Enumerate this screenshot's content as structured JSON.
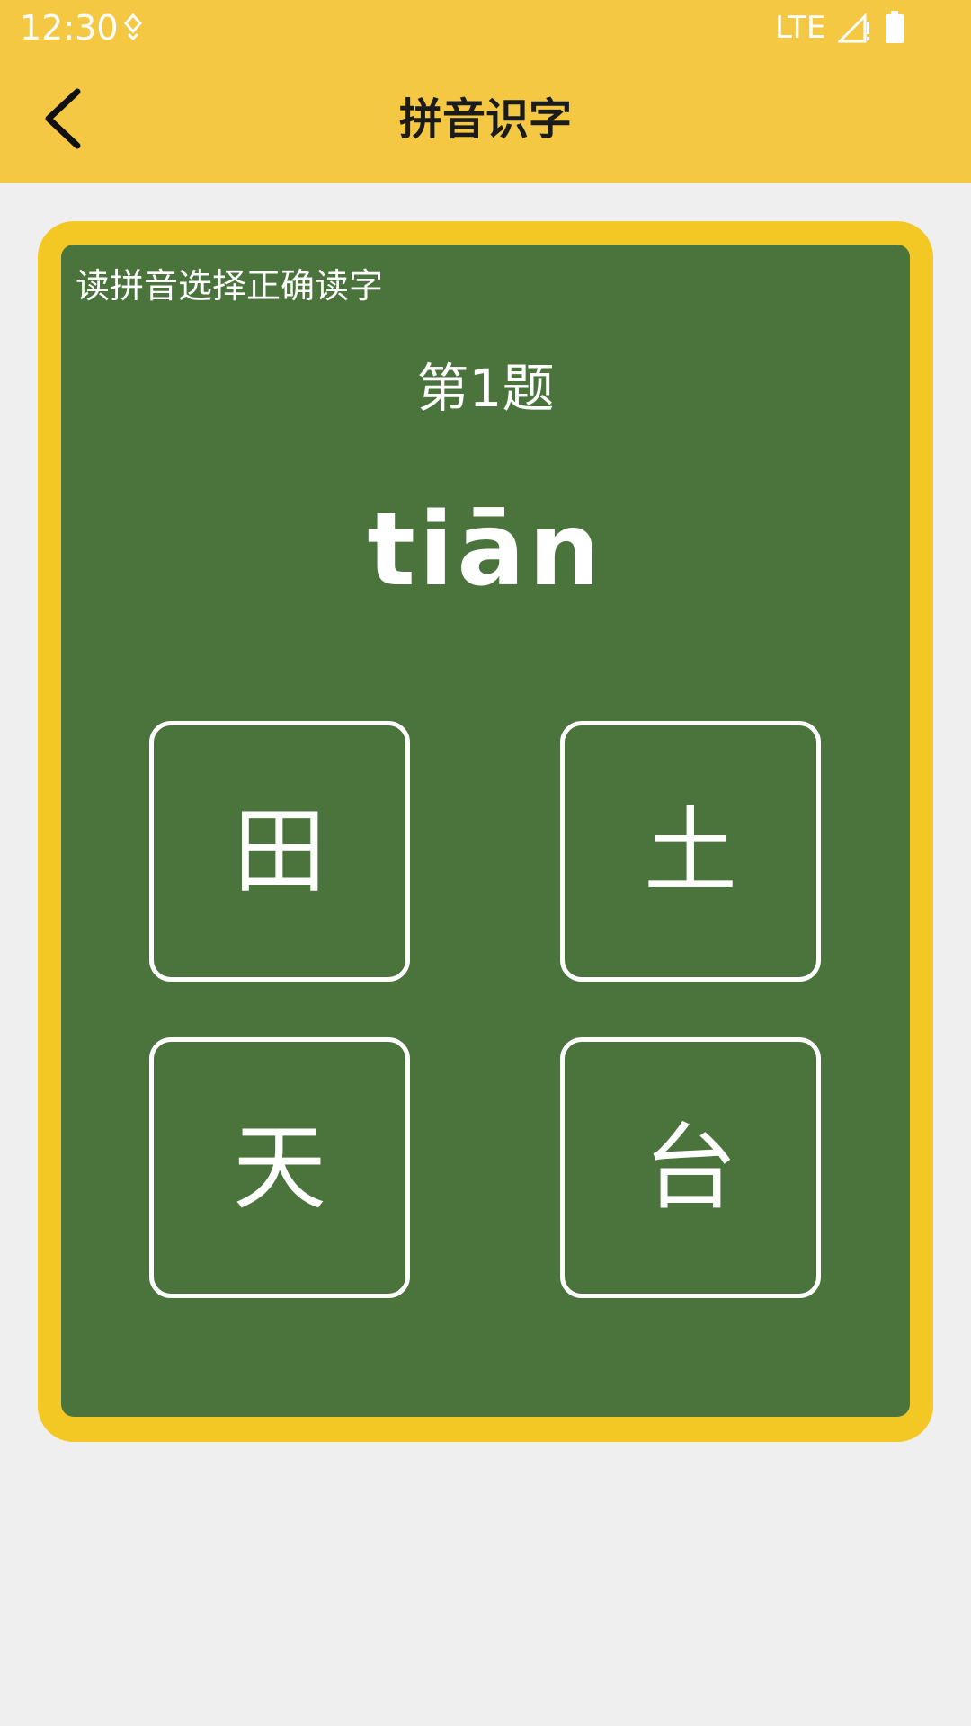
{
  "status_bar": {
    "time": "12:30",
    "network": "LTE"
  },
  "app_bar": {
    "title": "拼音识字"
  },
  "quiz": {
    "instruction": "读拼音选择正确读字",
    "question_number": "第1题",
    "pinyin": "tiān",
    "options": [
      "田",
      "土",
      "天",
      "台"
    ]
  },
  "colors": {
    "header": "#f4c842",
    "card_border": "#f4c824",
    "board": "#4a743c",
    "background": "#efefef"
  }
}
